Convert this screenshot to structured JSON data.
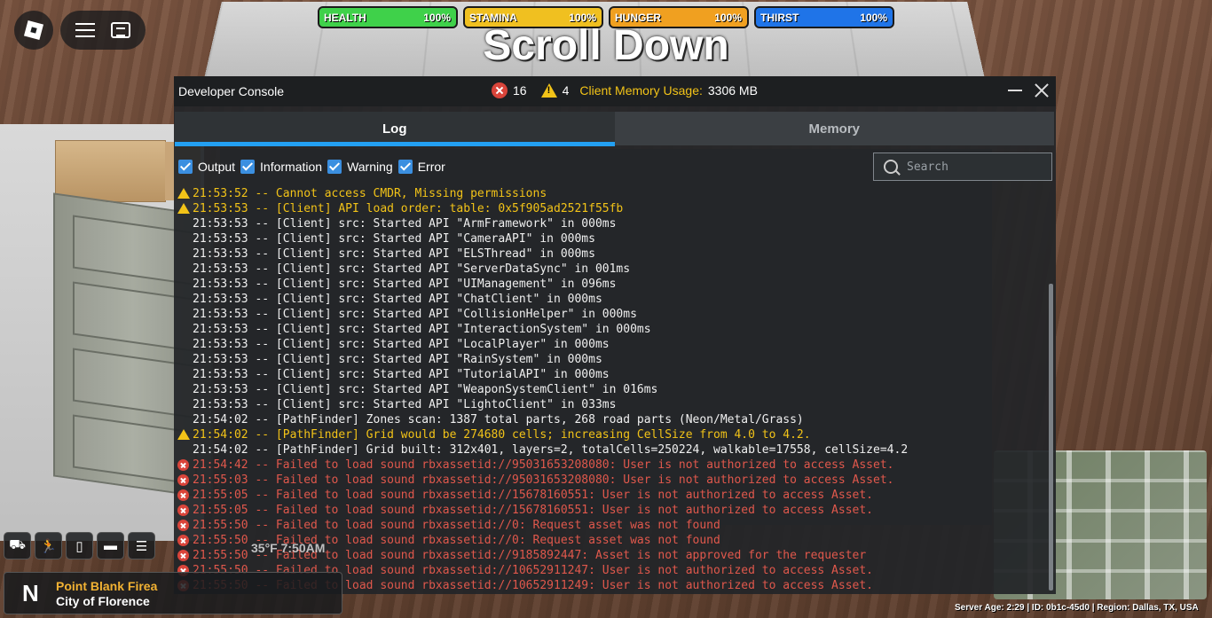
{
  "hud": {
    "stats": [
      {
        "label": "HEALTH",
        "value": "100%",
        "fill_fraction": 1.0,
        "color": "#3fd14a"
      },
      {
        "label": "STAMINA",
        "value": "100%",
        "fill_fraction": 1.0,
        "color": "#f0c020"
      },
      {
        "label": "HUNGER",
        "value": "100%",
        "fill_fraction": 1.0,
        "color": "#f0a020"
      },
      {
        "label": "THIRST",
        "value": "100%",
        "fill_fraction": 1.0,
        "color": "#1f74e8"
      }
    ],
    "banner": "Scroll Down",
    "clock": "35°F 7:50AM",
    "location": {
      "compass": "N",
      "place": "Point Blank Firea",
      "city": "City of Florence"
    },
    "server_info": "Server Age: 2:29 | ID: 0b1c-45d0 | Region: Dallas, TX, USA",
    "hotbar_icons": [
      "car-icon",
      "runner-icon",
      "phone-icon",
      "id-card-icon",
      "list-icon"
    ]
  },
  "console": {
    "title": "Developer Console",
    "error_count": "16",
    "warning_count": "4",
    "memory_label": "Client Memory Usage:",
    "memory_value": "3306 MB",
    "tabs": [
      {
        "label": "Log",
        "active": true
      },
      {
        "label": "Memory",
        "active": false
      }
    ],
    "filters": [
      {
        "label": "Output",
        "checked": true
      },
      {
        "label": "Information",
        "checked": true
      },
      {
        "label": "Warning",
        "checked": true
      },
      {
        "label": "Error",
        "checked": true
      }
    ],
    "search_placeholder": "Search",
    "log": [
      {
        "level": "warning",
        "text": "21:53:52 -- Cannot access CMDR, Missing permissions"
      },
      {
        "level": "warning",
        "text": "21:53:53 -- [Client] API load order: table: 0x5f905ad2521f55fb"
      },
      {
        "level": "output",
        "text": "21:53:53 -- [Client] src: Started API \"ArmFramework\" in 000ms"
      },
      {
        "level": "output",
        "text": "21:53:53 -- [Client] src: Started API \"CameraAPI\" in 000ms"
      },
      {
        "level": "output",
        "text": "21:53:53 -- [Client] src: Started API \"ELSThread\" in 000ms"
      },
      {
        "level": "output",
        "text": "21:53:53 -- [Client] src: Started API \"ServerDataSync\" in 001ms"
      },
      {
        "level": "output",
        "text": "21:53:53 -- [Client] src: Started API \"UIManagement\" in 096ms"
      },
      {
        "level": "output",
        "text": "21:53:53 -- [Client] src: Started API \"ChatClient\" in 000ms"
      },
      {
        "level": "output",
        "text": "21:53:53 -- [Client] src: Started API \"CollisionHelper\" in 000ms"
      },
      {
        "level": "output",
        "text": "21:53:53 -- [Client] src: Started API \"InteractionSystem\" in 000ms"
      },
      {
        "level": "output",
        "text": "21:53:53 -- [Client] src: Started API \"LocalPlayer\" in 000ms"
      },
      {
        "level": "output",
        "text": "21:53:53 -- [Client] src: Started API \"RainSystem\" in 000ms"
      },
      {
        "level": "output",
        "text": "21:53:53 -- [Client] src: Started API \"TutorialAPI\" in 000ms"
      },
      {
        "level": "output",
        "text": "21:53:53 -- [Client] src: Started API \"WeaponSystemClient\" in 016ms"
      },
      {
        "level": "output",
        "text": "21:53:53 -- [Client] src: Started API \"LightoClient\" in 033ms"
      },
      {
        "level": "output",
        "text": "21:54:02 -- [PathFinder] Zones scan: 1387 total parts, 268 road parts (Neon/Metal/Grass)"
      },
      {
        "level": "warning",
        "text": "21:54:02 -- [PathFinder] Grid would be 274680 cells; increasing CellSize from 4.0 to 4.2."
      },
      {
        "level": "output",
        "text": "21:54:02 -- [PathFinder] Grid built: 312x401, layers=2, totalCells=250224, walkable=17558, cellSize=4.2"
      },
      {
        "level": "error",
        "text": "21:54:42 -- Failed to load sound rbxassetid://95031653208080: User is not authorized to access Asset."
      },
      {
        "level": "error",
        "text": "21:55:03 -- Failed to load sound rbxassetid://95031653208080: User is not authorized to access Asset."
      },
      {
        "level": "error",
        "text": "21:55:05 -- Failed to load sound rbxassetid://15678160551: User is not authorized to access Asset."
      },
      {
        "level": "error",
        "text": "21:55:05 -- Failed to load sound rbxassetid://15678160551: User is not authorized to access Asset."
      },
      {
        "level": "error",
        "text": "21:55:50 -- Failed to load sound rbxassetid://0: Request asset was not found"
      },
      {
        "level": "error",
        "text": "21:55:50 -- Failed to load sound rbxassetid://0: Request asset was not found"
      },
      {
        "level": "error",
        "text": "21:55:50 -- Failed to load sound rbxassetid://9185892447: Asset is not approved for the requester"
      },
      {
        "level": "error",
        "text": "21:55:50 -- Failed to load sound rbxassetid://10652911247: User is not authorized to access Asset."
      },
      {
        "level": "error",
        "text": "21:55:50 -- Failed to load sound rbxassetid://10652911249: User is not authorized to access Asset."
      }
    ]
  },
  "colors": {
    "accent": "#23a0f2",
    "warning": "#f2c318",
    "error": "#e0584c"
  }
}
